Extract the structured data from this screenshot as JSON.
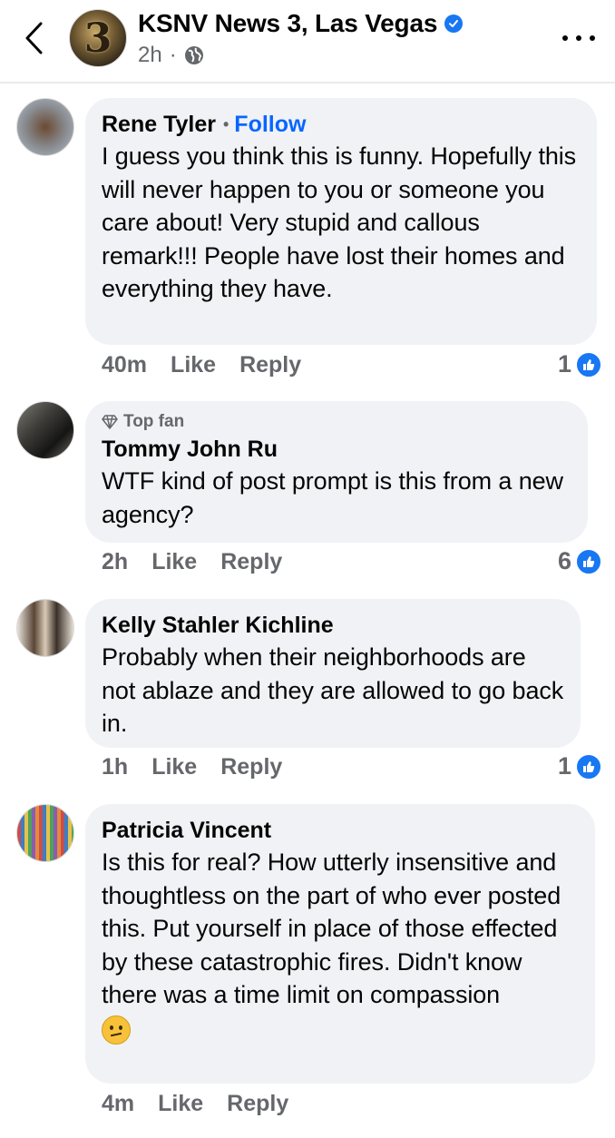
{
  "header": {
    "page_name": "KSNV News 3, Las Vegas",
    "time": "2h",
    "separator": "·",
    "avatar_glyph": "3"
  },
  "comments": [
    {
      "author": "Rene Tyler",
      "follow_label": "Follow",
      "text": "I guess you think this is funny. Hopefully this will never happen to you or someone you care about! Very stupid and callous remark!!! People have lost their homes and everything they have.",
      "time": "40m",
      "like_label": "Like",
      "reply_label": "Reply",
      "reaction_count": "1"
    },
    {
      "badge": "Top fan",
      "author": "Tommy John Ru",
      "text": "WTF kind of post prompt is this from a new agency?",
      "time": "2h",
      "like_label": "Like",
      "reply_label": "Reply",
      "reaction_count": "6"
    },
    {
      "author": "Kelly Stahler Kichline",
      "text": "Probably when their neighborhoods are not ablaze and they are allowed to go back in.",
      "time": "1h",
      "like_label": "Like",
      "reply_label": "Reply",
      "reaction_count": "1"
    },
    {
      "author": "Patricia Vincent",
      "text": "Is this for real? How utterly insensitive and thoughtless on the part of who ever posted this. Put yourself in place of those effected by these catastrophic fires. Didn't know there was a time limit on compassion",
      "emoji": "confused-face",
      "time": "4m",
      "like_label": "Like",
      "reply_label": "Reply"
    }
  ],
  "colors": {
    "accent": "#1877f2",
    "follow": "#0866ff",
    "bubble": "#f0f2f5",
    "muted": "#65676b"
  }
}
